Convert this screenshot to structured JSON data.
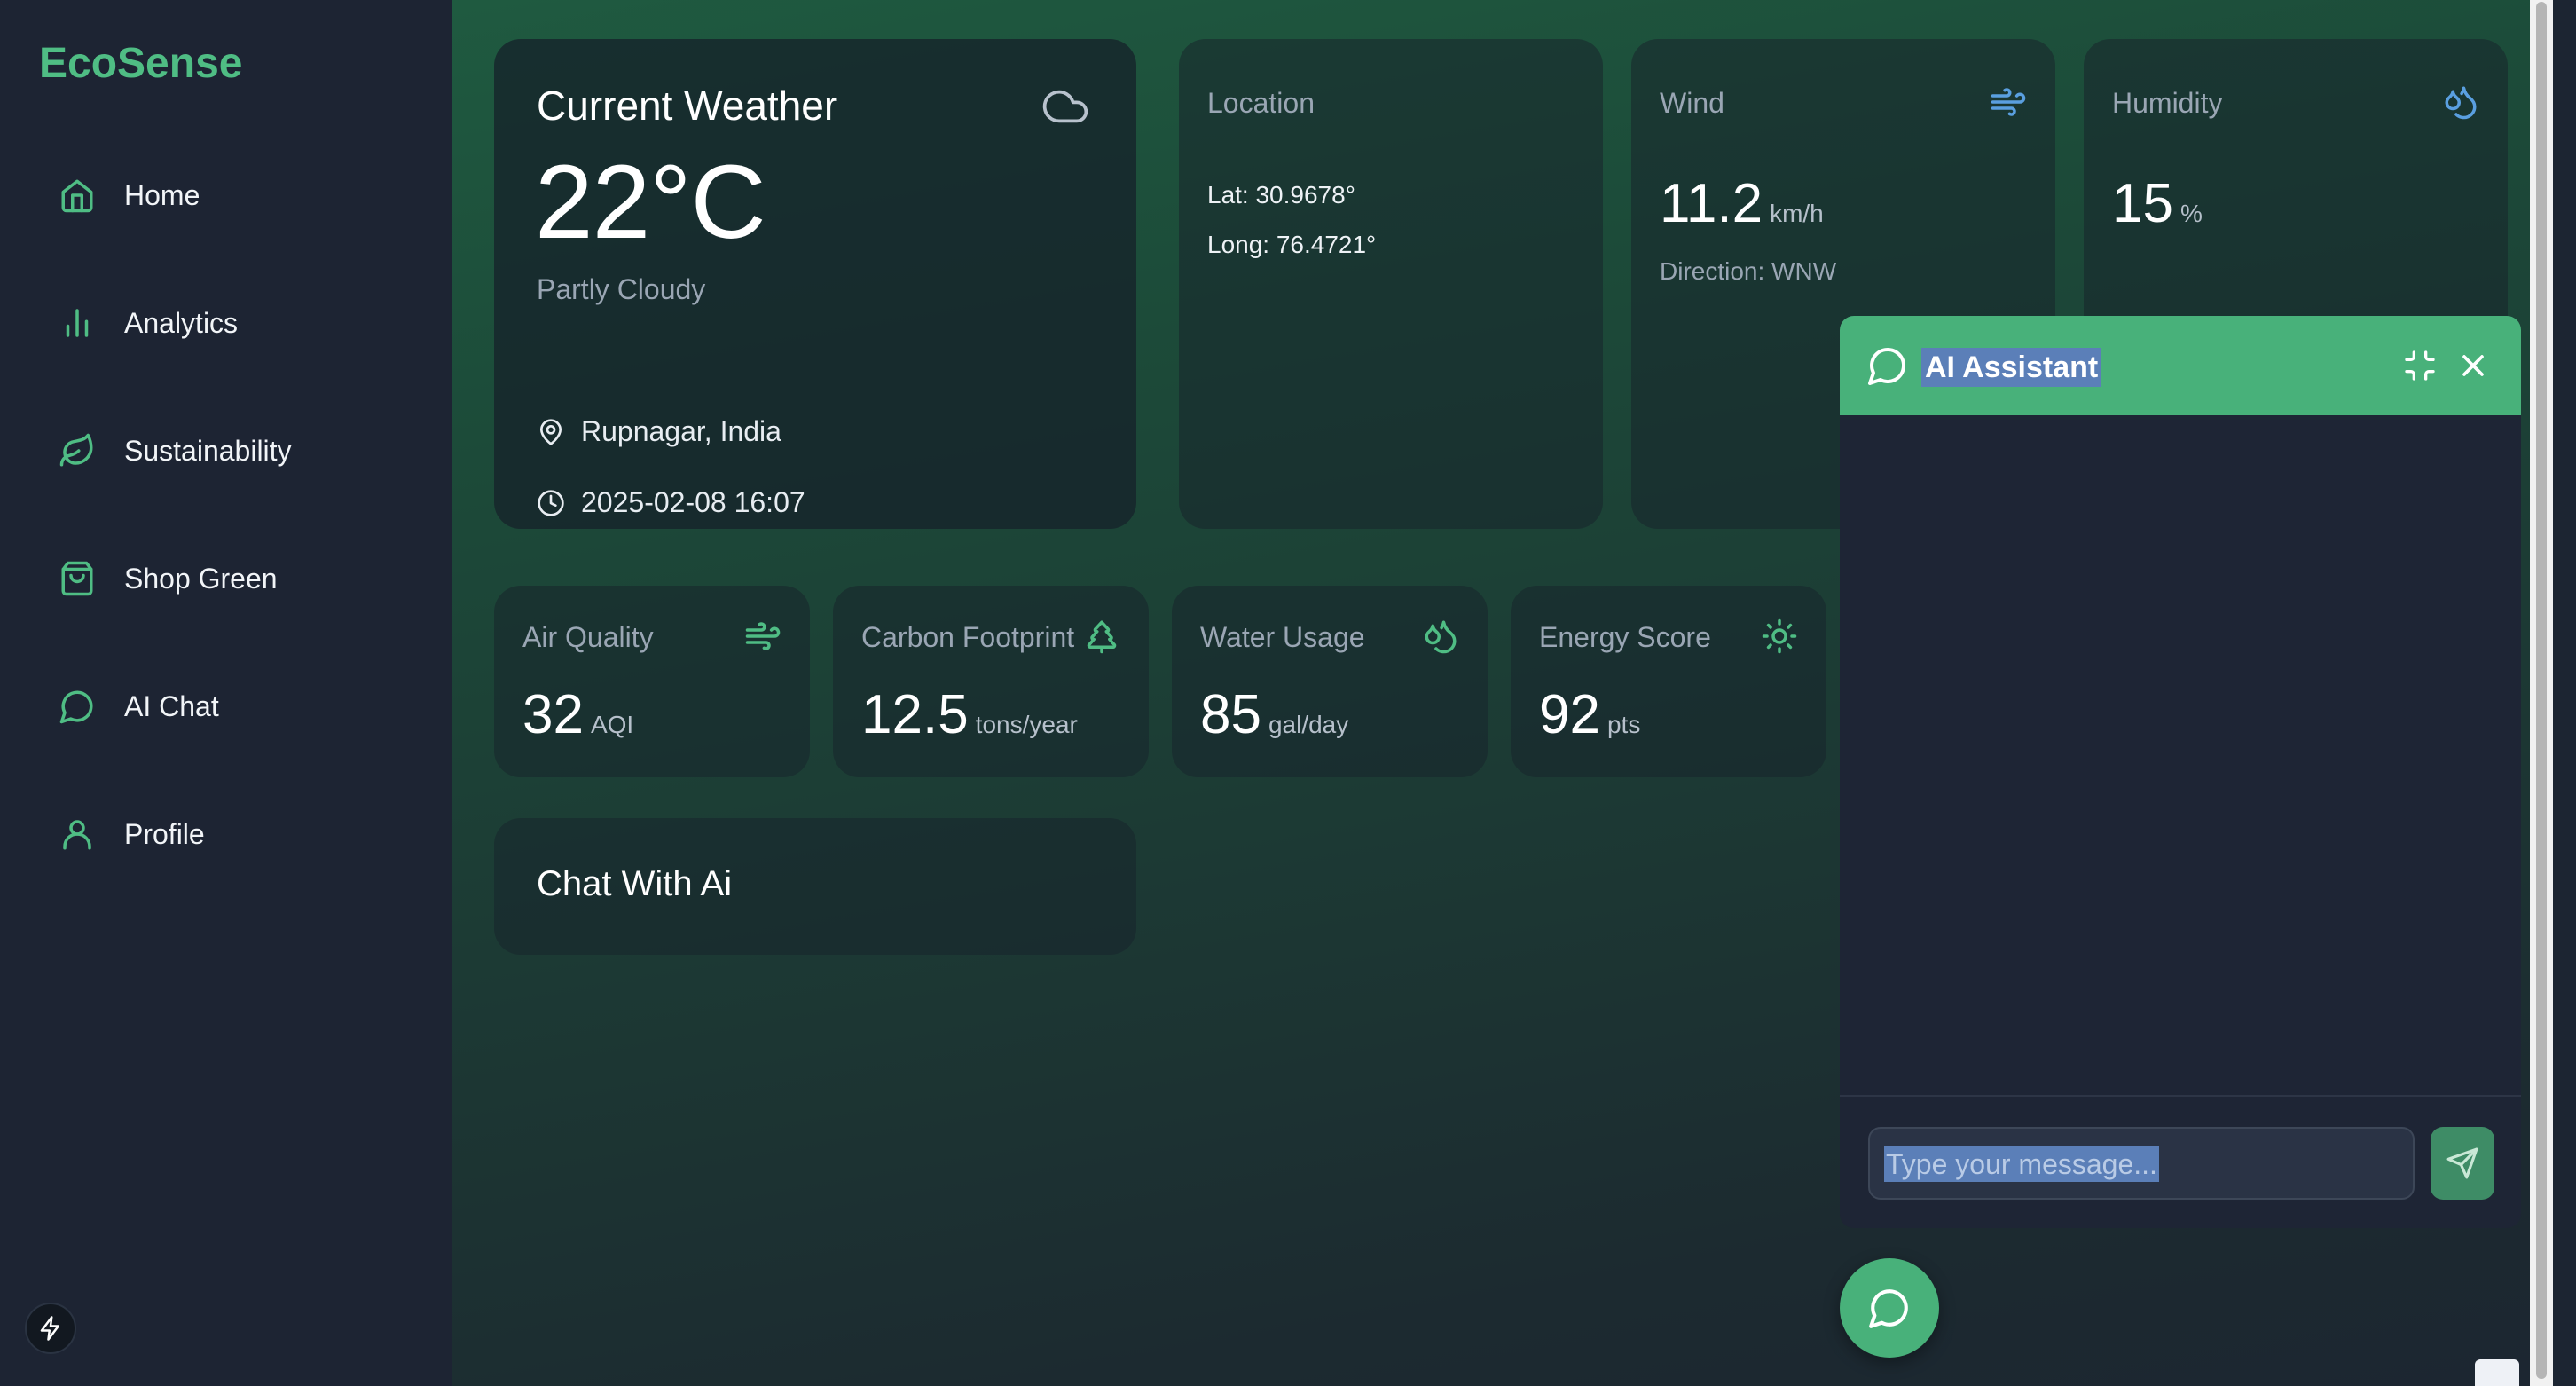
{
  "brand": "EcoSense",
  "nav": [
    {
      "label": "Home",
      "icon": "home-icon"
    },
    {
      "label": "Analytics",
      "icon": "bar-chart-icon"
    },
    {
      "label": "Sustainability",
      "icon": "leaf-icon"
    },
    {
      "label": "Shop Green",
      "icon": "shopping-bag-icon"
    },
    {
      "label": "AI Chat",
      "icon": "message-circle-icon"
    },
    {
      "label": "Profile",
      "icon": "user-icon"
    }
  ],
  "weather": {
    "title": "Current Weather",
    "temperature": "22°C",
    "condition": "Partly Cloudy",
    "place": "Rupnagar, India",
    "datetime": "2025-02-08 16:07"
  },
  "location": {
    "label": "Location",
    "lat": "Lat: 30.9678°",
    "long": "Long: 76.4721°"
  },
  "wind": {
    "label": "Wind",
    "value": "11.2",
    "unit": "km/h",
    "direction": "Direction: WNW"
  },
  "humidity": {
    "label": "Humidity",
    "value": "15",
    "unit": "%"
  },
  "metrics": [
    {
      "label": "Air Quality",
      "value": "32",
      "unit": "AQI",
      "icon": "wind-icon"
    },
    {
      "label": "Carbon Footprint",
      "value": "12.5",
      "unit": "tons/year",
      "icon": "tree-icon"
    },
    {
      "label": "Water Usage",
      "value": "85",
      "unit": "gal/day",
      "icon": "droplets-icon"
    },
    {
      "label": "Energy Score",
      "value": "92",
      "unit": "pts",
      "icon": "sun-icon"
    }
  ],
  "chat_card": {
    "title": "Chat With Ai"
  },
  "assistant": {
    "title": "AI Assistant",
    "placeholder": "Type your message..."
  },
  "colors": {
    "accent": "#48b17a",
    "brand": "#4fbd84",
    "sidebar": "#1d2433",
    "highlight": "#5b7fb8"
  }
}
